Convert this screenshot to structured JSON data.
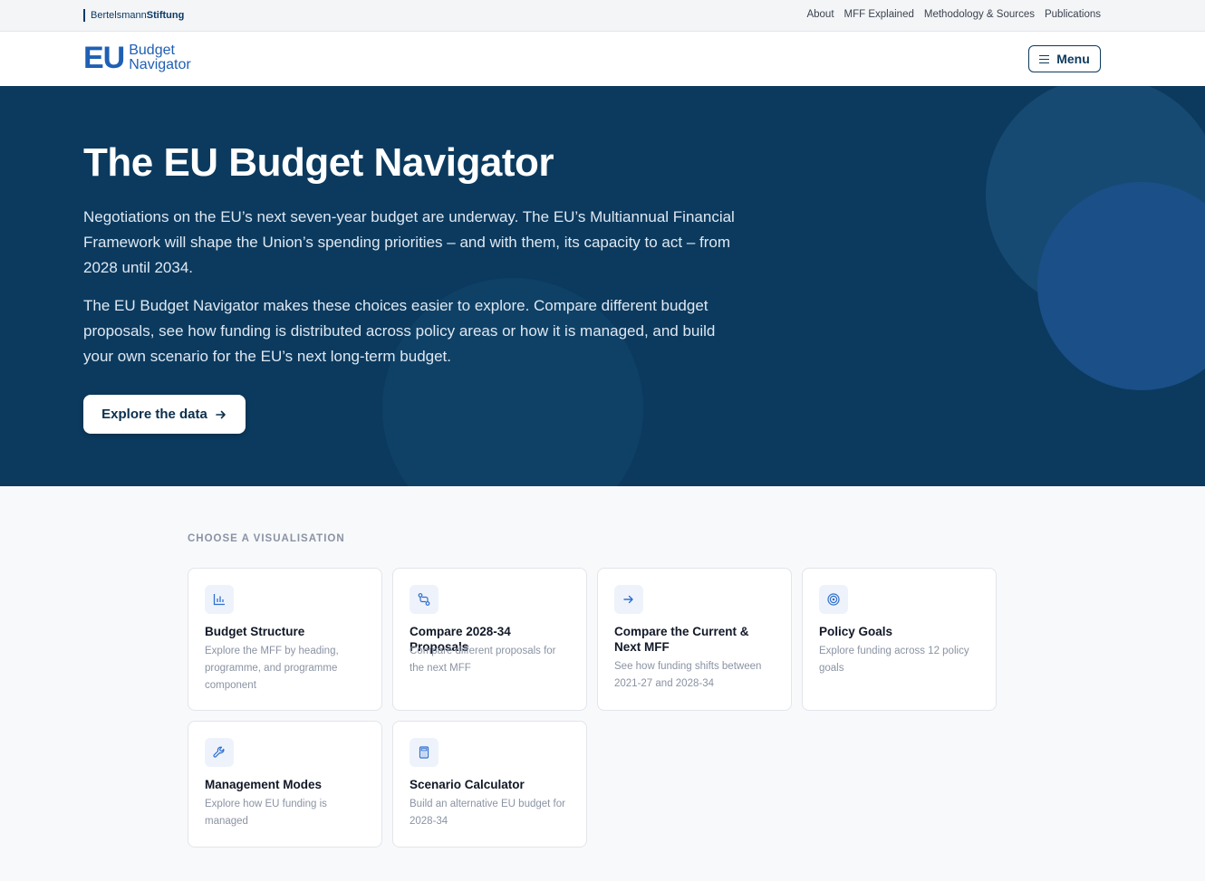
{
  "topbar": {
    "brand_part1": "Bertelsmann",
    "brand_part2": "Stiftung",
    "links": [
      "About",
      "MFF Explained",
      "Methodology & Sources",
      "Publications"
    ]
  },
  "header": {
    "logo_mark": "EU",
    "logo_line1": "Budget",
    "logo_line2": "Navigator",
    "menu_label": "Menu",
    "menu_icon": "hamburger-icon"
  },
  "hero": {
    "title": "The EU Budget Navigator",
    "paragraph1": "Negotiations on the EU’s next seven-year budget are underway. The EU’s Multiannual Financial Framework will shape the Union’s spending priorities – and with them, its capacity to act – from 2028 until 2034.",
    "paragraph2": "The EU Budget Navigator makes these choices easier to explore. Compare different budget proposals, see how funding is distributed across policy areas or how it is managed, and build your own scenario for the EU’s next long-term budget.",
    "cta_label": "Explore the data",
    "cta_icon": "arrow-right-icon"
  },
  "visualisations": {
    "label": "CHOOSE A VISUALISATION",
    "cards": [
      {
        "title": "Budget Structure",
        "desc": "Explore the MFF by heading, programme, and programme component",
        "icon": "bar-chart-icon"
      },
      {
        "title": "Compare 2028-34 Proposals",
        "desc": "Compare different proposals for the next MFF",
        "icon": "compare-icon"
      },
      {
        "title": "Compare the Current & Next MFF",
        "desc": "See how funding shifts between 2021-27 and 2028-34",
        "icon": "arrow-right-icon"
      },
      {
        "title": "Policy Goals",
        "desc": "Explore funding across 12 policy goals",
        "icon": "target-icon"
      },
      {
        "title": "Management Modes",
        "desc": "Explore how EU funding is managed",
        "icon": "wrench-icon"
      },
      {
        "title": "Scenario Calculator",
        "desc": "Build an alternative EU budget for 2028-34",
        "icon": "calculator-icon"
      }
    ]
  },
  "colors": {
    "hero_bg": "#0b3a5e",
    "brand_blue": "#1f5fb4",
    "page_bg": "#f8f9fb"
  }
}
